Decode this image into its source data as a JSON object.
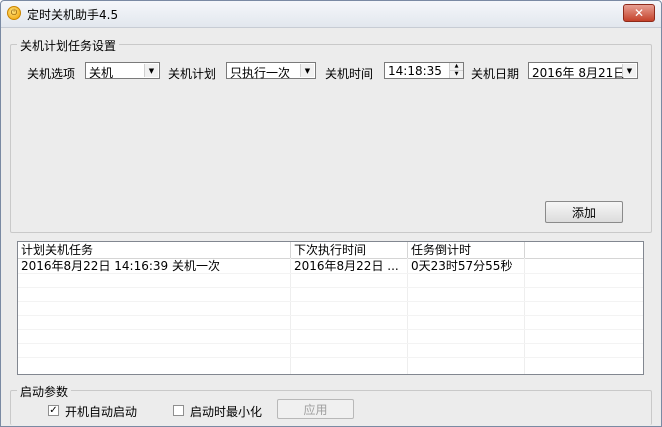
{
  "window": {
    "title": "定时关机助手4.5",
    "close_glyph": "✕"
  },
  "plan_group": {
    "legend": "关机计划任务设置",
    "option_label": "关机选项",
    "option_value": "关机",
    "plan_label": "关机计划",
    "plan_value": "只执行一次",
    "time_label": "关机时间",
    "time_value": "14:18:35",
    "date_label": "关机日期",
    "date_value": "2016年 8月21日",
    "add_button": "添加"
  },
  "task_list": {
    "columns": [
      "计划关机任务",
      "下次执行时间",
      "任务倒计时",
      ""
    ],
    "rows": [
      [
        "2016年8月22日 14:16:39 关机一次",
        "2016年8月22日 ...",
        "0天23时57分55秒"
      ]
    ]
  },
  "startup_group": {
    "legend": "启动参数",
    "autostart_label": "开机自动启动",
    "autostart_checked": true,
    "minimize_label": "启动时最小化",
    "minimize_checked": false,
    "apply_button": "应用"
  },
  "icons": {
    "app": "power-icon",
    "check_glyph": "✓",
    "arrow_glyph": "▼",
    "spin_up": "▲",
    "spin_down": "▼"
  }
}
